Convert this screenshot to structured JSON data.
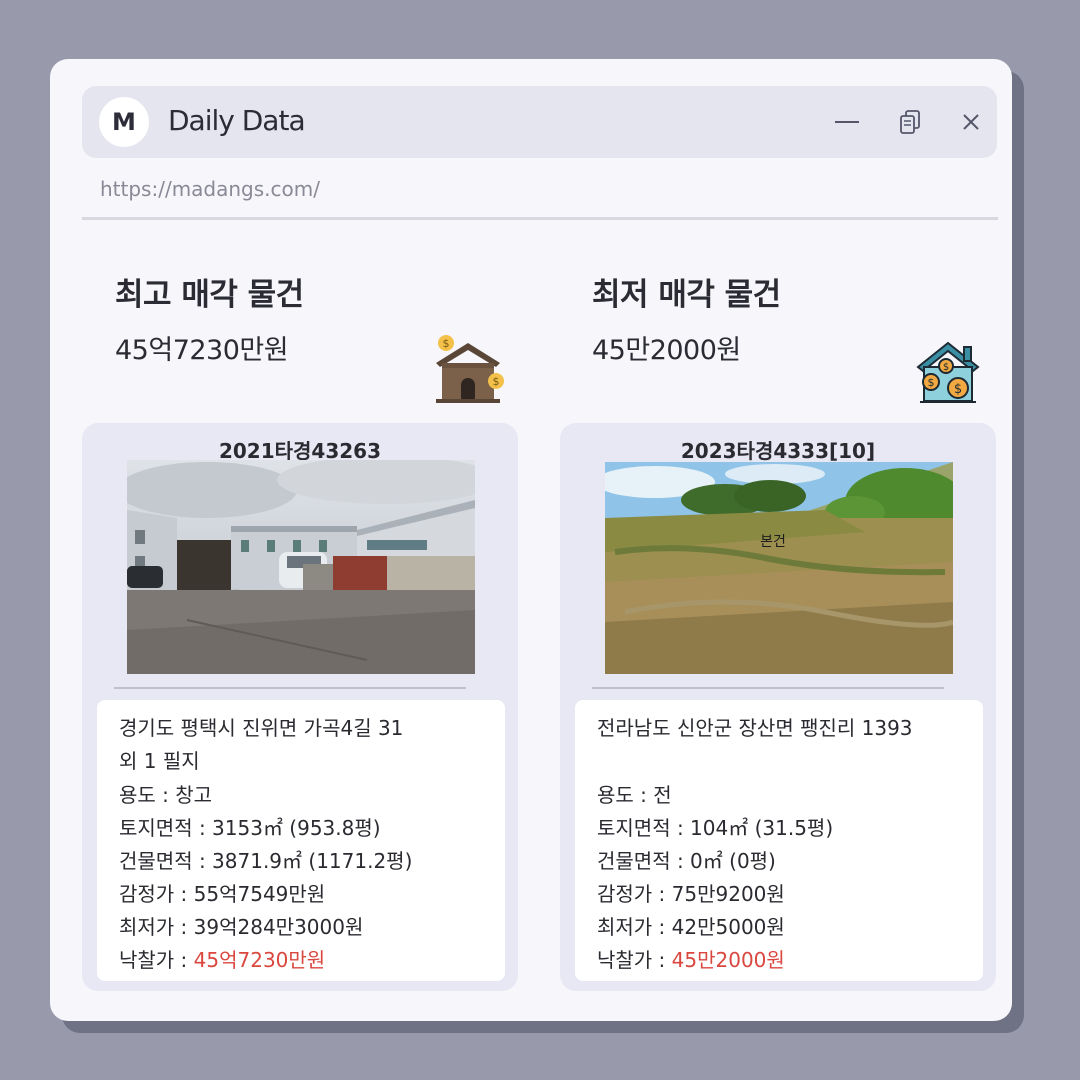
{
  "window": {
    "avatar_letter": "M",
    "title": "Daily Data",
    "url": "https://madangs.com/"
  },
  "highest": {
    "heading": "최고 매각 물건",
    "price": "45억7230만원",
    "case_no": "2021타경43263",
    "address_line1": "경기도 평택시 진위면 가곡4길 31",
    "address_line2": "외 1 필지",
    "usage": "용도 : 창고",
    "land_area": "토지면적 : 3153㎡ (953.8평)",
    "building_area": "건물면적 : 3871.9㎡ (1171.2평)",
    "appraisal": "감정가 : 55억7549만원",
    "minimum": "최저가 : 39억284만3000원",
    "winning_label": "낙찰가 : ",
    "winning_value": "45억7230만원"
  },
  "lowest": {
    "heading": "최저 매각 물건",
    "price": "45만2000원",
    "case_no": "2023타경4333[10]",
    "photo_label": "본건",
    "address_line1": "전라남도 신안군 장산면 팽진리 1393",
    "usage": "용도 : 전",
    "land_area": "토지면적 : 104㎡ (31.5평)",
    "building_area": "건물면적 : 0㎡ (0평)",
    "appraisal": "감정가 : 75만9200원",
    "minimum": "최저가 : 42만5000원",
    "winning_label": "낙찰가 : ",
    "winning_value": "45만2000원"
  },
  "colors": {
    "accent_red": "#d9473f",
    "card_bg": "#e7e8f4"
  },
  "icons": [
    "minimize-icon",
    "restore-icon",
    "close-icon",
    "house-money-icon",
    "house-coins-icon"
  ]
}
